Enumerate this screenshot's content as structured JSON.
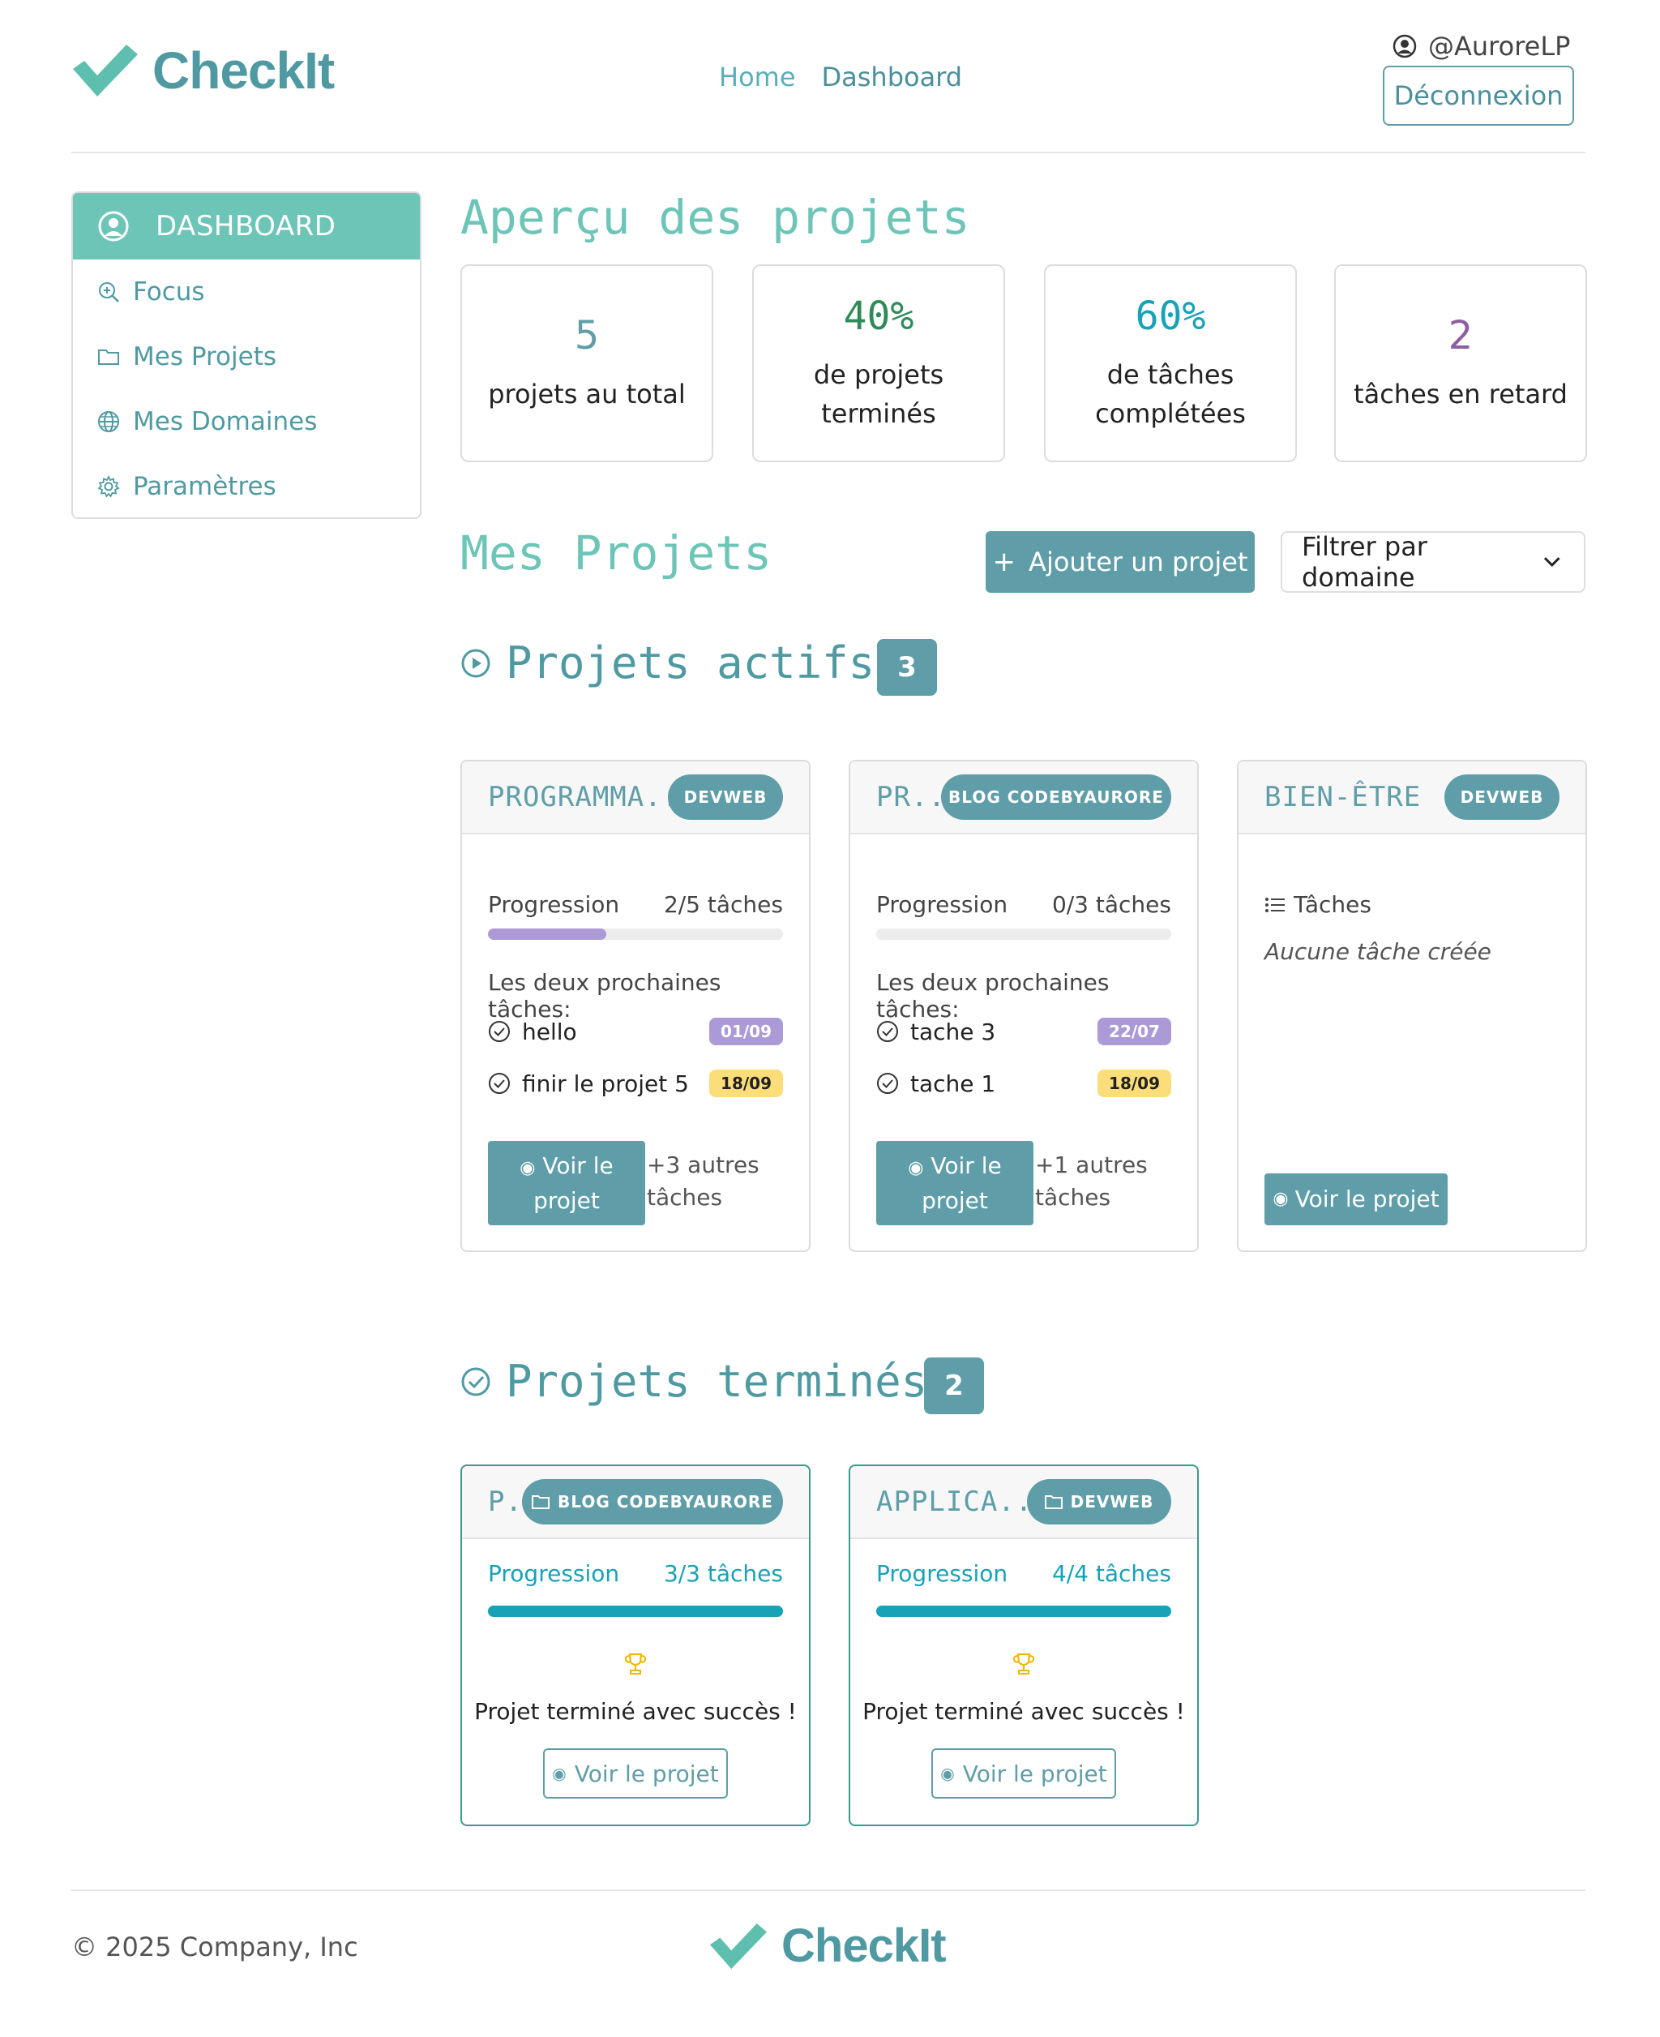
{
  "app": {
    "name": "CheckIt",
    "brand_color": "#4f9aa2",
    "accent_color": "#6cc5b7"
  },
  "nav": {
    "home": "Home",
    "dashboard": "Dashboard"
  },
  "user": {
    "username": "@AuroreLP",
    "logout_label": "Déconnexion"
  },
  "sidebar": {
    "items": [
      {
        "label": "DASHBOARD",
        "icon": "user-circle-icon",
        "active": true
      },
      {
        "label": "Focus",
        "icon": "zoom-in-icon"
      },
      {
        "label": "Mes Projets",
        "icon": "folder-icon"
      },
      {
        "label": "Mes Domaines",
        "icon": "globe-icon"
      },
      {
        "label": "Paramètres",
        "icon": "gear-icon"
      }
    ]
  },
  "overview": {
    "title": "Aperçu des projets",
    "stats": [
      {
        "value": "5",
        "label_line1": "projets au total",
        "label_line2": "",
        "color": "#5f9ea8"
      },
      {
        "value": "40%",
        "label_line1": "de projets",
        "label_line2": "terminés",
        "color": "#2e8b57"
      },
      {
        "value": "60%",
        "label_line1": "de tâches",
        "label_line2": "complétées",
        "color": "#17a2b8"
      },
      {
        "value": "2",
        "label_line1": "tâches en retard",
        "label_line2": "",
        "color": "#8e5ea2"
      }
    ]
  },
  "projects": {
    "title": "Mes Projets",
    "add_label": "Ajouter un projet",
    "filter_label": "Filtrer par domaine",
    "active": {
      "title": "Projets actifs",
      "count": "3",
      "cards": [
        {
          "name": "PROGRAMMA...",
          "domain": "DEVWEB",
          "progress_label": "Progression",
          "progress_text": "2/5 tâches",
          "progress_fraction": 0.4,
          "next_label": "Les deux prochaines tâches:",
          "tasks": [
            {
              "name": "hello",
              "date": "01/09",
              "badge": "purple"
            },
            {
              "name": "finir le projet 5",
              "date": "18/09",
              "badge": "yellow"
            }
          ],
          "view_line1": "Voir le",
          "view_line2": "projet",
          "more_line1": "+3 autres",
          "more_line2": "tâches"
        },
        {
          "name": "PR...",
          "domain": "BLOG CODEBYAURORE",
          "progress_label": "Progression",
          "progress_text": "0/3 tâches",
          "progress_fraction": 0,
          "next_label": "Les deux prochaines tâches:",
          "tasks": [
            {
              "name": "tache 3",
              "date": "22/07",
              "badge": "purple"
            },
            {
              "name": "tache 1",
              "date": "18/09",
              "badge": "yellow"
            }
          ],
          "view_line1": "Voir le",
          "view_line2": "projet",
          "more_line1": "+1 autres",
          "more_line2": "tâches"
        },
        {
          "name": "BIEN-ÊTRE",
          "domain": "DEVWEB",
          "tasks_label": "Tâches",
          "no_tasks": "Aucune tâche créée",
          "view_label": "Voir le projet"
        }
      ]
    },
    "done": {
      "title": "Projets terminés",
      "count": "2",
      "cards": [
        {
          "name": "P...",
          "domain": "BLOG CODEBYAURORE",
          "progress_label": "Progression",
          "progress_text": "3/3 tâches",
          "progress_fraction": 1,
          "success": "Projet terminé avec succès !",
          "view_label": "Voir le projet"
        },
        {
          "name": "APPLICA...",
          "domain": "DEVWEB",
          "progress_label": "Progression",
          "progress_text": "4/4 tâches",
          "progress_fraction": 1,
          "success": "Projet terminé avec succès !",
          "view_label": "Voir le projet"
        }
      ]
    }
  },
  "footer": {
    "copyright": "© 2025 Company, Inc",
    "logo": "CheckIt"
  }
}
